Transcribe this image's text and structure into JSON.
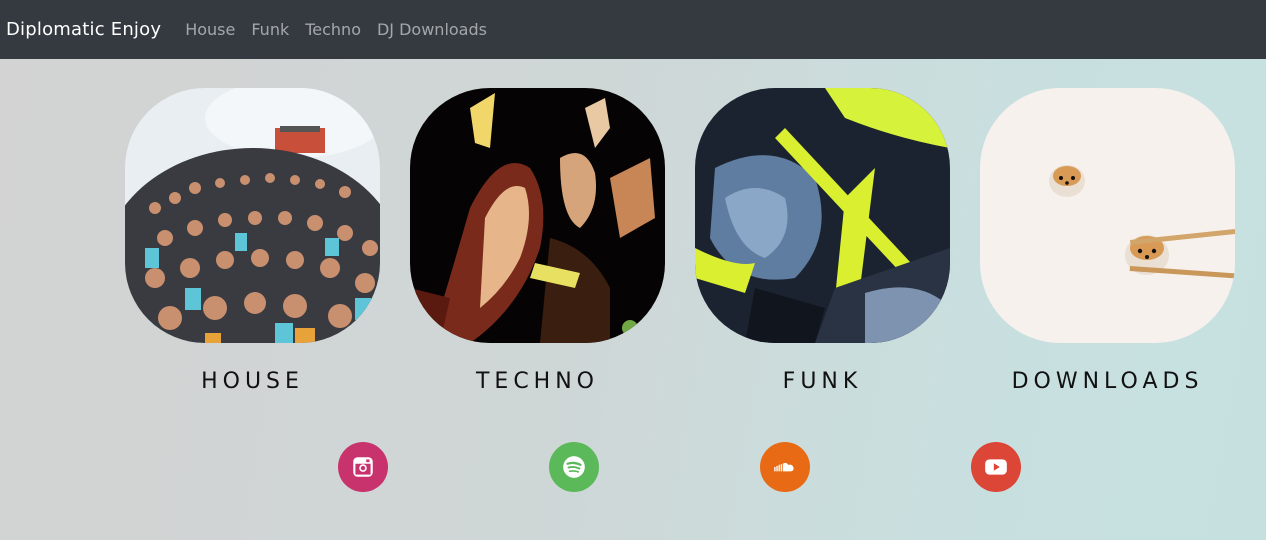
{
  "navbar": {
    "brand": "Diplomatic Enjoy",
    "links": [
      "House",
      "Funk",
      "Techno",
      "DJ Downloads"
    ]
  },
  "cards": [
    {
      "label": "HOUSE",
      "image": "festival-crowd-fisheye-photo"
    },
    {
      "label": "TECHNO",
      "image": "dancing-people-high-contrast-photo"
    },
    {
      "label": "FUNK",
      "image": "drummer-posterized-photo"
    },
    {
      "label": "DOWNLOADS",
      "image": "shiba-dumplings-chopsticks-photo"
    }
  ],
  "social": [
    {
      "name": "instagram-icon",
      "color": "#c8336d"
    },
    {
      "name": "spotify-icon",
      "color": "#5bb959"
    },
    {
      "name": "soundcloud-icon",
      "color": "#e86a14"
    },
    {
      "name": "youtube-icon",
      "color": "#dc4637"
    }
  ],
  "colors": {
    "navbar": "#343a40",
    "brand_text": "#ffffff",
    "nav_link": "#9a9da0"
  }
}
